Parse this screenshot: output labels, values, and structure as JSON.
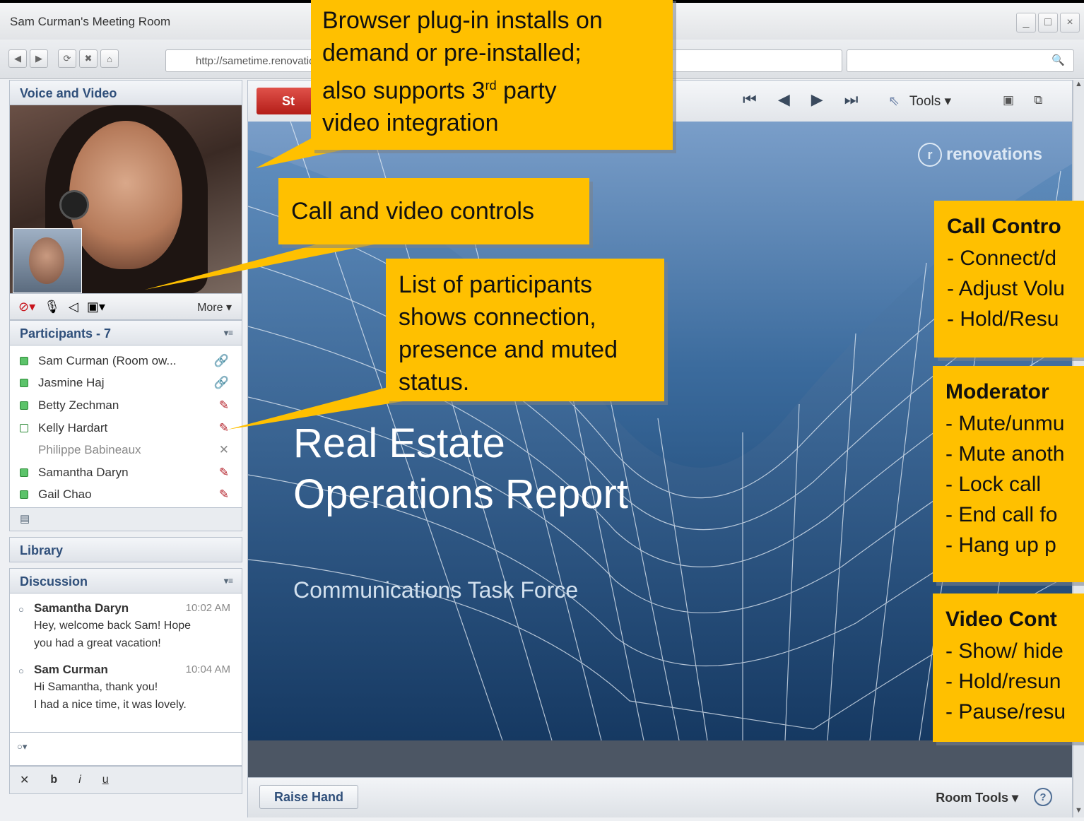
{
  "window": {
    "title": "Sam Curman's Meeting Room",
    "controls": [
      "_",
      "□",
      "×"
    ]
  },
  "browser": {
    "url": "http://sametime.renovations.com",
    "search_placeholder": ""
  },
  "voice_video": {
    "title": "Voice and Video",
    "more_label": "More ▾"
  },
  "participants": {
    "title": "Participants - 7",
    "list": [
      {
        "name": "Sam Curman (Room ow...",
        "status_icon": "link-icon"
      },
      {
        "name": "Jasmine Haj",
        "status_icon": "link-icon"
      },
      {
        "name": "Betty Zechman",
        "status_icon": "muted-icon"
      },
      {
        "name": "Kelly Hardart",
        "status_icon": "muted-icon"
      },
      {
        "name": "Philippe Babineaux",
        "status_icon": "disconnected-icon"
      },
      {
        "name": "Samantha Daryn",
        "status_icon": "muted-icon"
      },
      {
        "name": "Gail Chao",
        "status_icon": "muted-icon"
      }
    ]
  },
  "library": {
    "title": "Library"
  },
  "discussion": {
    "title": "Discussion",
    "messages": [
      {
        "author": "Samantha Daryn",
        "time": "10:02 AM",
        "line1": "Hey, welcome back Sam! Hope",
        "line2": "you had a great vacation!"
      },
      {
        "author": "Sam Curman",
        "time": "10:04 AM",
        "line1": "Hi Samantha, thank you!",
        "line2": "I had a nice time, it was lovely."
      }
    ],
    "format": [
      "b",
      "i",
      "u"
    ]
  },
  "toolbar": {
    "red_button_label": "St",
    "tools_label": "Tools ▾"
  },
  "slide": {
    "brand": "renovations",
    "title_line1": "Real Estate",
    "title_line2": "Operations Report",
    "subtitle": "Communications Task Force"
  },
  "footer": {
    "raise_hand_label": "Raise Hand",
    "room_tools_label": "Room Tools ▾"
  },
  "callouts": {
    "plugin": {
      "line1": "Browser plug-in installs on",
      "line2": "demand or pre-installed;",
      "line3a": "also supports 3",
      "line3sup": "rd",
      "line3b": " party",
      "line4": "video integration"
    },
    "controls": {
      "text": "Call and video controls"
    },
    "participants": {
      "line1": "List of participants",
      "line2": "shows connection,",
      "line3": "presence and muted",
      "line4": "status."
    },
    "call_controls": {
      "heading": "Call Contro",
      "items": [
        "- Connect/d",
        "- Adjust Volu",
        "- Hold/Resu"
      ]
    },
    "moderator": {
      "heading": "Moderator",
      "items": [
        "- Mute/unmu",
        "- Mute anoth",
        "- Lock call",
        "- End call fo",
        "- Hang up p"
      ]
    },
    "video_controls": {
      "heading": "Video Cont",
      "items": [
        "- Show/ hide",
        "- Hold/resun",
        "- Pause/resu"
      ]
    }
  },
  "colors": {
    "callout": "#ffc000",
    "hangup": "#c8141c",
    "muted": "#b4212a",
    "header_text": "#2f4f7a"
  }
}
